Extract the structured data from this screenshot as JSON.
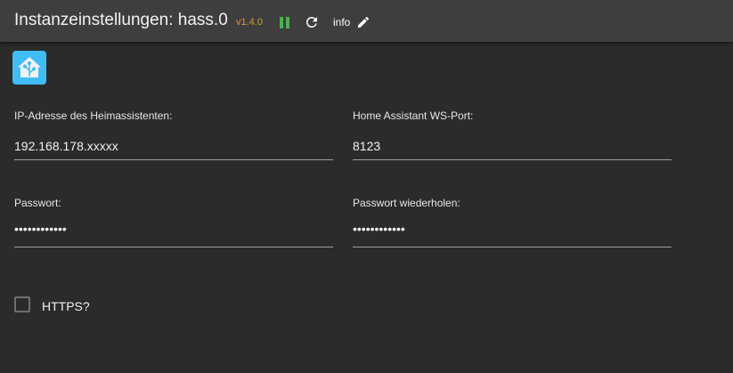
{
  "header": {
    "title": "Instanzeinstellungen: hass.0",
    "version": "v1.4.0",
    "info_label": "info",
    "icons": {
      "pause": "pause-icon",
      "restart": "restart-icon",
      "edit": "pencil-icon"
    },
    "colors": {
      "version": "#d79a2b",
      "pause": "#4caf50",
      "titlebar": "#3e3e3e"
    }
  },
  "logo": {
    "icon": "home-assistant-logo-icon",
    "color": "#41bdf5"
  },
  "form": {
    "ip": {
      "label": "IP-Adresse des Heimassistenten:",
      "value": "192.168.178.xxxxx"
    },
    "port": {
      "label": "Home Assistant WS-Port:",
      "value": "8123"
    },
    "password": {
      "label": "Passwort:",
      "masked": "••••••••••••"
    },
    "password_repeat": {
      "label": "Passwort wiederholen:",
      "masked": "••••••••••••"
    },
    "https": {
      "label": "HTTPS?",
      "checked": false
    }
  }
}
